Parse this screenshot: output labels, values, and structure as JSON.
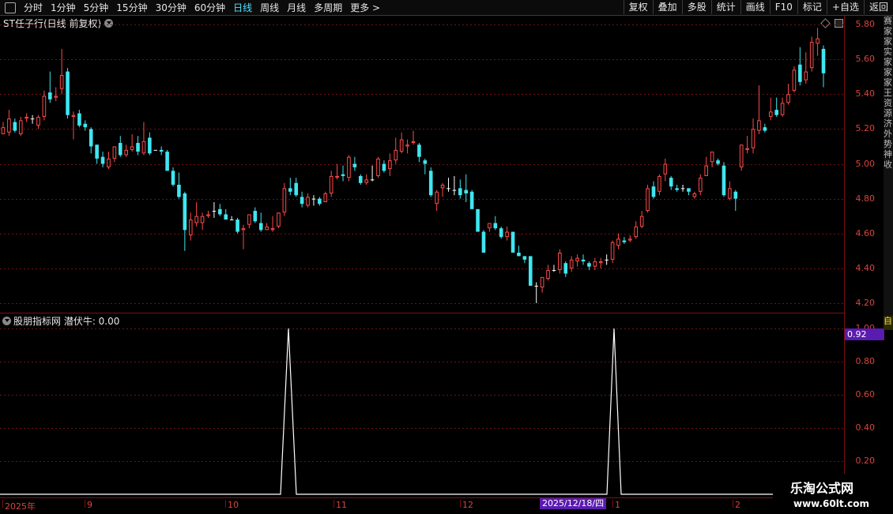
{
  "toolbar": {
    "left": [
      "分时",
      "1分钟",
      "5分钟",
      "15分钟",
      "30分钟",
      "60分钟",
      "日线",
      "周线",
      "月线",
      "多周期",
      "更多 >"
    ],
    "active_index": 6,
    "right": [
      "复权",
      "叠加",
      "多股",
      "统计",
      "画线",
      "F10",
      "标记",
      "+自选",
      "返回"
    ]
  },
  "main_title": "ST任子行(日线 前复权)",
  "indicator_title": "股朋指标网 潜伏牛: 0.00",
  "indicator_current": "0.92",
  "price_axis": [
    "5.80",
    "5.60",
    "5.40",
    "5.20",
    "5.00",
    "4.80",
    "4.60",
    "4.40",
    "4.20"
  ],
  "indicator_axis": [
    "1.00",
    "0.80",
    "0.60",
    "0.40",
    "0.20"
  ],
  "x_axis": [
    "2025年",
    "9",
    "10",
    "11",
    "12",
    "1",
    "2"
  ],
  "x_highlight": "2025/12/18/四",
  "side_strip": "赛家家实家家家王资源济外势神收",
  "side_label": "自",
  "watermark": {
    "line1": "乐淘公式网",
    "line2": "www.60lt.com"
  },
  "colors": {
    "up": "#ff4a4a",
    "down": "#3fe6f0",
    "grid": "#6b1414",
    "axis": "#d6453e"
  },
  "chart_data": {
    "type": "candlestick",
    "title": "ST任子行(日线 前复权)",
    "ylim": [
      4.15,
      5.85
    ],
    "candles": [
      [
        5.17,
        5.21,
        5.24,
        5.17
      ],
      [
        5.18,
        5.26,
        5.31,
        5.16
      ],
      [
        5.24,
        5.19,
        5.26,
        5.18
      ],
      [
        5.17,
        5.25,
        5.27,
        5.16
      ],
      [
        5.26,
        5.27,
        5.29,
        5.24
      ],
      [
        5.26,
        5.26,
        5.28,
        5.23
      ],
      [
        5.22,
        5.27,
        5.28,
        5.2
      ],
      [
        5.27,
        5.39,
        5.42,
        5.25
      ],
      [
        5.41,
        5.37,
        5.53,
        5.35
      ],
      [
        5.38,
        5.39,
        5.44,
        5.36
      ],
      [
        5.43,
        5.51,
        5.66,
        5.4
      ],
      [
        5.53,
        5.28,
        5.55,
        5.26
      ],
      [
        5.27,
        5.28,
        5.3,
        5.14
      ],
      [
        5.29,
        5.22,
        5.31,
        5.21
      ],
      [
        5.23,
        5.21,
        5.25,
        5.19
      ],
      [
        5.2,
        5.1,
        5.21,
        5.06
      ],
      [
        5.11,
        5.03,
        5.11,
        5.0
      ],
      [
        5.04,
        5.0,
        5.07,
        4.98
      ],
      [
        4.98,
        5.03,
        5.07,
        4.97
      ],
      [
        5.03,
        5.1,
        5.1,
        5.01
      ],
      [
        5.12,
        5.05,
        5.16,
        5.04
      ],
      [
        5.05,
        5.08,
        5.11,
        5.04
      ],
      [
        5.08,
        5.1,
        5.17,
        5.07
      ],
      [
        5.12,
        5.07,
        5.16,
        5.05
      ],
      [
        5.06,
        5.13,
        5.24,
        5.05
      ],
      [
        5.15,
        5.06,
        5.18,
        5.05
      ],
      [
        5.08,
        5.08,
        5.08,
        5.08
      ],
      [
        5.08,
        5.07,
        5.1,
        5.05
      ],
      [
        5.07,
        4.96,
        5.08,
        4.96
      ],
      [
        4.96,
        4.88,
        4.98,
        4.87
      ],
      [
        4.88,
        4.81,
        4.95,
        4.8
      ],
      [
        4.83,
        4.62,
        4.84,
        4.5
      ],
      [
        4.59,
        4.68,
        4.72,
        4.56
      ],
      [
        4.66,
        4.7,
        4.78,
        4.64
      ],
      [
        4.66,
        4.7,
        4.72,
        4.62
      ],
      [
        4.7,
        4.71,
        4.73,
        4.69
      ],
      [
        4.73,
        4.73,
        4.78,
        4.69
      ],
      [
        4.74,
        4.71,
        4.77,
        4.7
      ],
      [
        4.71,
        4.68,
        4.74,
        4.68
      ],
      [
        4.68,
        4.68,
        4.7,
        4.68
      ],
      [
        4.68,
        4.61,
        4.69,
        4.6
      ],
      [
        4.62,
        4.63,
        4.65,
        4.51
      ],
      [
        4.65,
        4.71,
        4.71,
        4.63
      ],
      [
        4.73,
        4.67,
        4.75,
        4.66
      ],
      [
        4.66,
        4.62,
        4.72,
        4.61
      ],
      [
        4.62,
        4.64,
        4.66,
        4.62
      ],
      [
        4.62,
        4.63,
        4.7,
        4.61
      ],
      [
        4.64,
        4.72,
        4.72,
        4.63
      ],
      [
        4.72,
        4.86,
        4.89,
        4.7
      ],
      [
        4.86,
        4.84,
        4.92,
        4.82
      ],
      [
        4.89,
        4.82,
        4.92,
        4.81
      ],
      [
        4.81,
        4.77,
        4.84,
        4.75
      ],
      [
        4.76,
        4.81,
        4.83,
        4.75
      ],
      [
        4.8,
        4.8,
        4.82,
        4.76
      ],
      [
        4.8,
        4.77,
        4.81,
        4.76
      ],
      [
        4.78,
        4.83,
        4.84,
        4.78
      ],
      [
        4.83,
        4.93,
        4.96,
        4.81
      ],
      [
        4.92,
        4.93,
        5.0,
        4.91
      ],
      [
        4.94,
        4.93,
        4.99,
        4.9
      ],
      [
        4.92,
        5.04,
        5.05,
        4.9
      ],
      [
        5.0,
        4.98,
        5.04,
        4.96
      ],
      [
        4.93,
        4.89,
        4.94,
        4.88
      ],
      [
        4.89,
        4.91,
        4.94,
        4.88
      ],
      [
        4.91,
        4.91,
        4.99,
        4.9
      ],
      [
        4.93,
        5.03,
        5.04,
        4.92
      ],
      [
        5.0,
        4.96,
        5.02,
        4.95
      ],
      [
        4.97,
        5.02,
        5.06,
        4.93
      ],
      [
        5.02,
        5.08,
        5.15,
        5.0
      ],
      [
        5.07,
        5.14,
        5.18,
        5.06
      ],
      [
        5.1,
        5.11,
        5.14,
        5.06
      ],
      [
        5.12,
        5.13,
        5.19,
        5.11
      ],
      [
        5.11,
        5.04,
        5.12,
        5.01
      ],
      [
        5.02,
        5.0,
        5.03,
        4.94
      ],
      [
        4.96,
        4.82,
        4.98,
        4.81
      ],
      [
        4.77,
        4.84,
        4.85,
        4.73
      ],
      [
        4.86,
        4.88,
        4.89,
        4.81
      ],
      [
        4.86,
        4.86,
        4.92,
        4.84
      ],
      [
        4.85,
        4.85,
        4.93,
        4.82
      ],
      [
        4.86,
        4.82,
        4.91,
        4.8
      ],
      [
        4.85,
        4.83,
        4.94,
        4.78
      ],
      [
        4.84,
        4.74,
        4.85,
        4.74
      ],
      [
        4.74,
        4.61,
        4.74,
        4.61
      ],
      [
        4.61,
        4.49,
        4.62,
        4.49
      ],
      [
        4.63,
        4.66,
        4.66,
        4.61
      ],
      [
        4.66,
        4.63,
        4.7,
        4.62
      ],
      [
        4.63,
        4.58,
        4.64,
        4.57
      ],
      [
        4.58,
        4.61,
        4.64,
        4.56
      ],
      [
        4.61,
        4.49,
        4.61,
        4.49
      ],
      [
        4.49,
        4.47,
        4.53,
        4.47
      ],
      [
        4.47,
        4.45,
        4.47,
        4.43
      ],
      [
        4.47,
        4.3,
        4.47,
        4.3
      ],
      [
        4.3,
        4.3,
        4.32,
        4.2
      ],
      [
        4.29,
        4.35,
        4.35,
        4.26
      ],
      [
        4.34,
        4.39,
        4.42,
        4.33
      ],
      [
        4.39,
        4.39,
        4.42,
        4.38
      ],
      [
        4.39,
        4.49,
        4.51,
        4.37
      ],
      [
        4.43,
        4.37,
        4.44,
        4.35
      ],
      [
        4.4,
        4.45,
        4.47,
        4.38
      ],
      [
        4.44,
        4.46,
        4.48,
        4.41
      ],
      [
        4.45,
        4.44,
        4.48,
        4.42
      ],
      [
        4.43,
        4.41,
        4.44,
        4.39
      ],
      [
        4.41,
        4.44,
        4.46,
        4.39
      ],
      [
        4.43,
        4.44,
        4.46,
        4.4
      ],
      [
        4.45,
        4.45,
        4.48,
        4.42
      ],
      [
        4.45,
        4.55,
        4.56,
        4.43
      ],
      [
        4.53,
        4.57,
        4.6,
        4.51
      ],
      [
        4.56,
        4.55,
        4.58,
        4.54
      ],
      [
        4.56,
        4.57,
        4.59,
        4.55
      ],
      [
        4.58,
        4.64,
        4.67,
        4.57
      ],
      [
        4.64,
        4.7,
        4.73,
        4.63
      ],
      [
        4.73,
        4.86,
        4.88,
        4.72
      ],
      [
        4.87,
        4.81,
        4.9,
        4.8
      ],
      [
        4.84,
        4.93,
        4.94,
        4.82
      ],
      [
        4.94,
        5.0,
        5.03,
        4.9
      ],
      [
        4.92,
        4.87,
        4.93,
        4.85
      ],
      [
        4.86,
        4.85,
        4.88,
        4.84
      ],
      [
        4.86,
        4.86,
        4.88,
        4.84
      ],
      [
        4.86,
        4.84,
        4.86,
        4.82
      ],
      [
        4.81,
        4.83,
        4.84,
        4.8
      ],
      [
        4.84,
        4.92,
        4.94,
        4.82
      ],
      [
        4.93,
        4.99,
        5.04,
        4.93
      ],
      [
        5.01,
        5.07,
        5.07,
        4.98
      ],
      [
        5.02,
        5.0,
        5.03,
        4.99
      ],
      [
        4.99,
        4.82,
        5.01,
        4.81
      ],
      [
        4.8,
        4.86,
        4.9,
        4.79
      ],
      [
        4.84,
        4.8,
        4.85,
        4.73
      ],
      [
        4.98,
        5.11,
        5.11,
        4.96
      ],
      [
        5.08,
        5.09,
        5.16,
        5.06
      ],
      [
        5.09,
        5.2,
        5.26,
        5.06
      ],
      [
        5.19,
        5.25,
        5.45,
        5.17
      ],
      [
        5.21,
        5.19,
        5.23,
        5.18
      ],
      [
        5.27,
        5.3,
        5.38,
        5.25
      ],
      [
        5.31,
        5.28,
        5.38,
        5.27
      ],
      [
        5.28,
        5.35,
        5.38,
        5.27
      ],
      [
        5.35,
        5.4,
        5.46,
        5.34
      ],
      [
        5.42,
        5.54,
        5.56,
        5.41
      ],
      [
        5.57,
        5.47,
        5.67,
        5.45
      ],
      [
        5.48,
        5.53,
        5.64,
        5.46
      ],
      [
        5.55,
        5.7,
        5.73,
        5.53
      ],
      [
        5.69,
        5.72,
        5.78,
        5.62
      ],
      [
        5.66,
        5.52,
        5.68,
        5.44
      ]
    ]
  }
}
